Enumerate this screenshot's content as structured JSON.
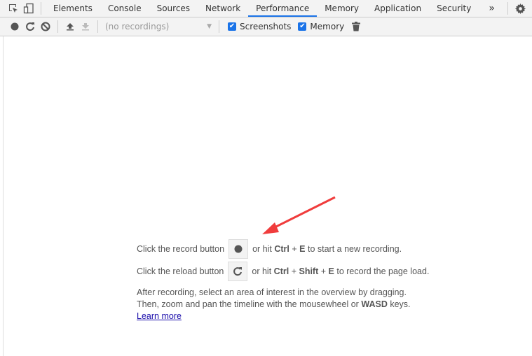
{
  "tabs": [
    {
      "label": "Elements"
    },
    {
      "label": "Console"
    },
    {
      "label": "Sources"
    },
    {
      "label": "Network"
    },
    {
      "label": "Performance",
      "active": true
    },
    {
      "label": "Memory"
    },
    {
      "label": "Application"
    },
    {
      "label": "Security"
    }
  ],
  "more_tabs_label": "»",
  "toolbar": {
    "recordings_select": "(no recordings)",
    "screenshots_label": "Screenshots",
    "screenshots_checked": true,
    "memory_label": "Memory",
    "memory_checked": true
  },
  "landing": {
    "line1_pre": "Click the record button",
    "line1_mid": "or hit",
    "line1_k1": "Ctrl",
    "plus": "+",
    "line1_k2": "E",
    "line1_post": "to start a new recording.",
    "line2_pre": "Click the reload button",
    "line2_mid": "or hit",
    "line2_k1": "Ctrl",
    "line2_k2": "Shift",
    "line2_k3": "E",
    "line2_post": "to record the page load.",
    "para1": "After recording, select an area of interest in the overview by dragging.",
    "para2_pre": "Then, zoom and pan the timeline with the mousewheel or",
    "para2_bold": "WASD",
    "para2_post": "keys.",
    "learn_more": "Learn more"
  },
  "colors": {
    "accent": "#1a73e8",
    "annotation_arrow": "#f03c3c"
  }
}
